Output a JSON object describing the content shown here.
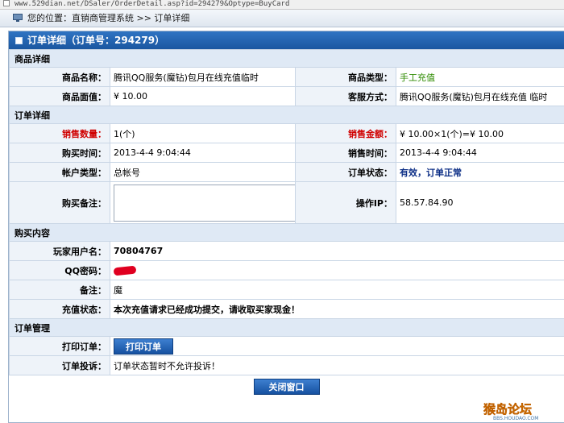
{
  "browser": {
    "url": "www.529dian.net/DSaler/OrderDetail.asp?id=294279&Optype=BuyCard"
  },
  "location": {
    "text": "您的位置：直销商管理系统 >> 订单详细"
  },
  "panel": {
    "title": "订单详细（订单号：294279）"
  },
  "sections": {
    "product": "商品详细",
    "order": "订单详细",
    "purchase": "购买内容",
    "manage": "订单管理"
  },
  "product": {
    "name_label": "商品名称：",
    "name_value": "腾讯QQ服务(魔钻)包月在线充值临时",
    "type_label": "商品类型：",
    "type_value": "手工充值",
    "face_label": "商品面值：",
    "face_value": "¥ 10.00",
    "service_label": "客服方式：",
    "service_value": "腾讯QQ服务(魔钻)包月在线充值 临时"
  },
  "order": {
    "qty_label": "销售数量：",
    "qty_value": "1(个)",
    "amount_label": "销售金额：",
    "amount_value": "¥ 10.00×1(个)=¥ 10.00",
    "buy_time_label": "购买时间：",
    "buy_time_value": "2013-4-4 9:04:44",
    "sale_time_label": "销售时间：",
    "sale_time_value": "2013-4-4 9:04:44",
    "account_label": "帐户类型：",
    "account_value": "总帐号",
    "status_label": "订单状态：",
    "status_value": "有效，订单正常",
    "remark_label": "购买备注：",
    "remark_value": "",
    "ip_label": "操作IP：",
    "ip_value": "58.57.84.90"
  },
  "purchase": {
    "user_label": "玩家用户名：",
    "user_value": "70804767",
    "pwd_label": "QQ密码：",
    "note_label": "备注：",
    "note_value": "魔",
    "charge_label": "充值状态：",
    "charge_value": "本次充值请求已经成功提交，请收取买家现金！"
  },
  "manage": {
    "print_label": "打印订单：",
    "print_button": "打印订单",
    "complain_label": "订单投诉：",
    "complain_value": "订单状态暂时不允许投诉！"
  },
  "footer": {
    "close_button": "关闭窗口"
  },
  "watermark": {
    "text": "猴岛论坛",
    "sub": "BBS.HOUDAO.COM"
  }
}
